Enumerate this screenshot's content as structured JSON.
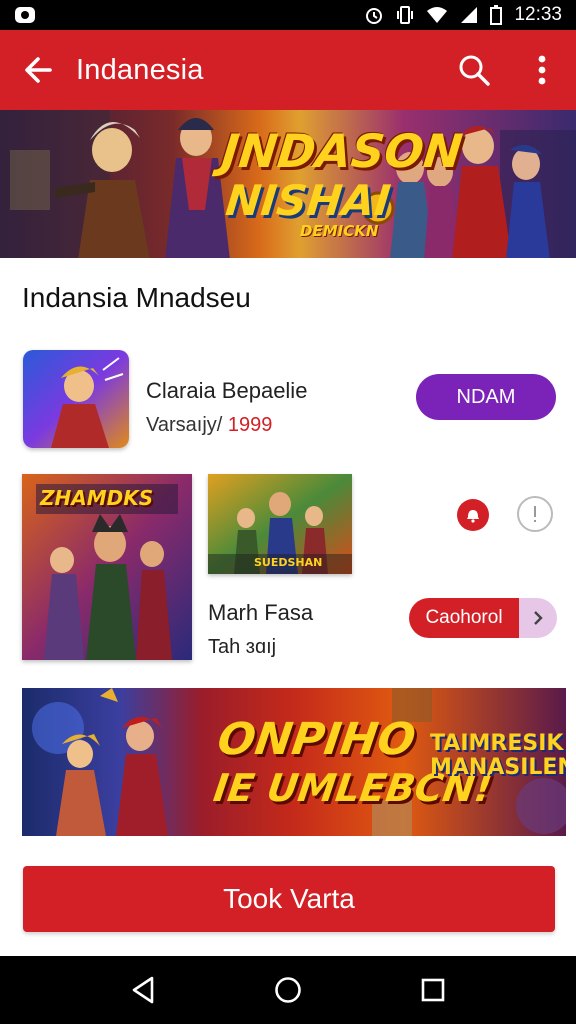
{
  "status_bar": {
    "time": "12:33",
    "icons": [
      "app-notification-icon",
      "alarm-icon",
      "vibrate-icon",
      "wifi-icon",
      "signal-icon",
      "battery-icon"
    ]
  },
  "app_bar": {
    "title": "Indanesia",
    "icons": [
      "back-arrow-icon",
      "search-icon",
      "more-vert-icon"
    ],
    "color": "#d32026"
  },
  "hero_banner": {
    "line1": "JNDASON",
    "line2": "NISHAI",
    "line3": "DEMICKN"
  },
  "section": {
    "title": "Indansia Mnadseu"
  },
  "app_item": {
    "name": "Claraia Bepaelie",
    "version_label": "Varsaıjy/",
    "version_number": "1999",
    "button_label": "NDAM",
    "button_color": "#7b22b8"
  },
  "media_item": {
    "poster_large_text": "ZHAMDKS",
    "poster_small_text": "SUEDSHAN",
    "name": "Marh Fasa",
    "subtitle": "Tah ɜɑıj",
    "chip_label": "Caohorol",
    "chip_side_icon": "chevron-right-icon"
  },
  "promo_banner": {
    "line1": "ONPIHO",
    "line2": "IE UMLEBCN!",
    "badge": "TAIMRESIK MANASILEN"
  },
  "cta": {
    "label": "Took Varta"
  },
  "nav_bar": {
    "icons": [
      "nav-back-icon",
      "nav-home-icon",
      "nav-recents-icon"
    ]
  }
}
